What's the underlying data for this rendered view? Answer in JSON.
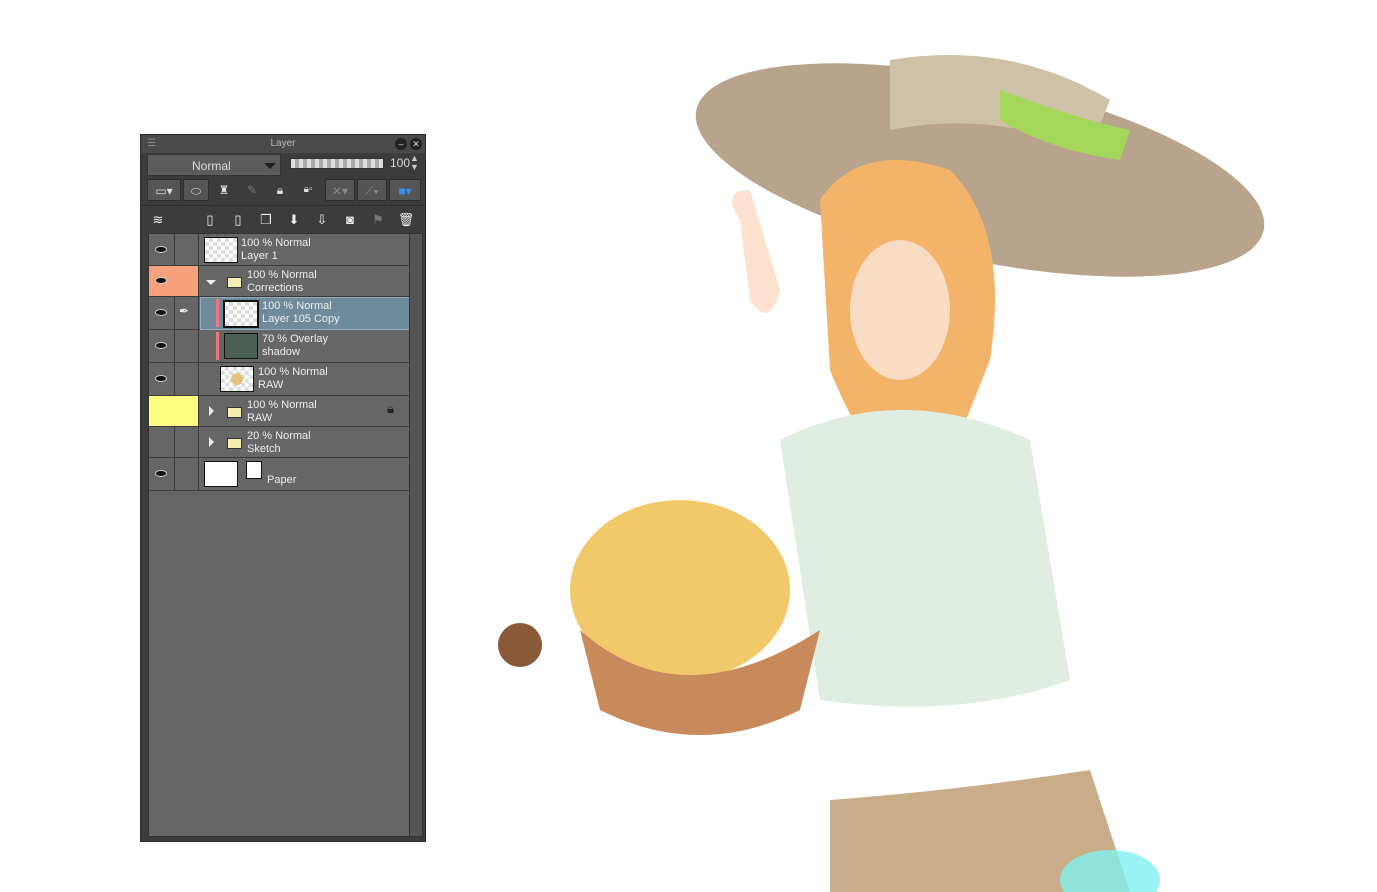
{
  "panel": {
    "title": "Layer",
    "blend_mode": "Normal",
    "opacity": "100",
    "layers": [
      {
        "opacity_mode": "100 % Normal",
        "name": "Layer 1"
      },
      {
        "opacity_mode": "100 % Normal",
        "name": "Corrections"
      },
      {
        "opacity_mode": "100 % Normal",
        "name": "Layer 105 Copy"
      },
      {
        "opacity_mode": "70 % Overlay",
        "name": "shadow"
      },
      {
        "opacity_mode": "100 % Normal",
        "name": "RAW"
      },
      {
        "opacity_mode": "100 % Normal",
        "name": "RAW"
      },
      {
        "opacity_mode": "20 % Normal",
        "name": "Sketch"
      },
      {
        "name": "Paper"
      }
    ]
  },
  "colors": {
    "selected": "#6f8a9a",
    "orange_tag": "#f7a27c",
    "yellow_tag": "#fefe80"
  }
}
